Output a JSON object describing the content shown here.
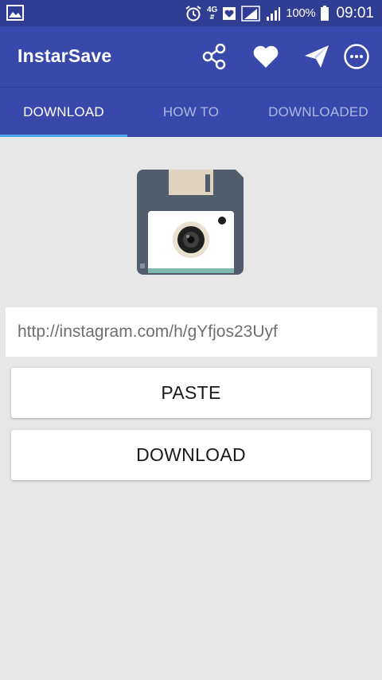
{
  "status_bar": {
    "network": "4G",
    "battery_level": "100%",
    "time": "09:01",
    "icons": [
      "image-icon",
      "alarm-icon",
      "network-4g-icon",
      "heart-notification-icon",
      "signal-icon",
      "signal-icon-2",
      "battery-icon"
    ]
  },
  "app_bar": {
    "title": "InstarSave",
    "actions": [
      "share-icon",
      "heart-icon",
      "send-icon",
      "more-options-icon"
    ]
  },
  "tabs": [
    {
      "label": "DOWNLOAD",
      "active": true
    },
    {
      "label": "HOW TO",
      "active": false
    },
    {
      "label": "DOWNLOADED",
      "active": false
    }
  ],
  "main": {
    "logo_icon": "floppy-camera-icon",
    "url_input": {
      "placeholder": "http://instagram.com/h/gYfjos23Uyf"
    },
    "paste_button": "PASTE",
    "download_button": "DOWNLOAD"
  },
  "colors": {
    "status_bar": "#2f3e92",
    "primary": "#3949ab",
    "tab_indicator": "#4aa7f0",
    "background": "#e7e7e7"
  }
}
